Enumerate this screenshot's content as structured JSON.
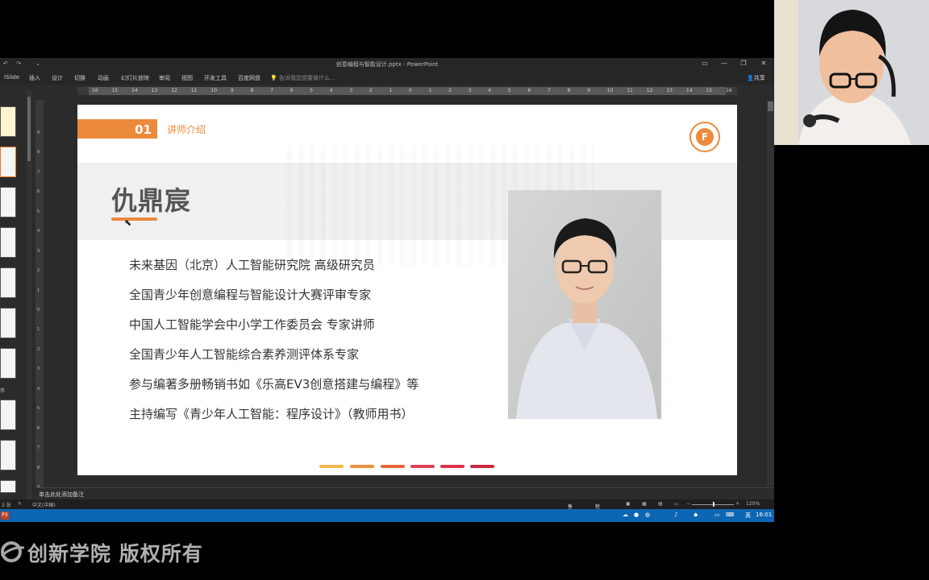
{
  "window": {
    "title": "创意编程与智能设计.pptx - PowerPoint",
    "controls": [
      "▭",
      "—",
      "❐",
      "✕"
    ]
  },
  "ribbon": {
    "tabs": [
      "iSlide",
      "插入",
      "设计",
      "切换",
      "动画",
      "幻灯片放映",
      "审阅",
      "视图",
      "开发工具",
      "百度网盘"
    ],
    "tell_me": "告诉我您想要做什么...",
    "share": "共享"
  },
  "ruler": {
    "h_ticks": [
      "16",
      "15",
      "14",
      "13",
      "12",
      "11",
      "10",
      "9",
      "8",
      "7",
      "6",
      "5",
      "4",
      "3",
      "2",
      "1",
      "0",
      "1",
      "2",
      "3",
      "4",
      "5",
      "6",
      "7",
      "8",
      "9",
      "10",
      "11",
      "12",
      "13",
      "14",
      "15",
      "16"
    ],
    "v_ticks": [
      "9",
      "8",
      "7",
      "6",
      "5",
      "4",
      "3",
      "2",
      "1",
      "0",
      "1",
      "2",
      "3",
      "4",
      "5",
      "6",
      "7",
      "8",
      "9"
    ]
  },
  "slide": {
    "section_number": "01",
    "section_title": "讲师介绍",
    "logo_letter": "F",
    "name": "仇鼎宸",
    "bio": [
      "未来基因（北京）人工智能研究院 高级研究员",
      "全国青少年创意编程与智能设计大赛评审专家",
      "中国人工智能学会中小学工作委员会 专家讲师",
      "全国青少年人工智能综合素养测评体系专家",
      "参与编著多册畅销书如《乐高EV3创意搭建与编程》等",
      "主持编写《青少年人工智能：程序设计》（教师用书）"
    ],
    "dash_colors": [
      "#f1b84b",
      "#ec8f3c",
      "#e4643c",
      "#dc4252",
      "#d8334a",
      "#c8283e"
    ]
  },
  "colors": {
    "accent": "#ec8a3c"
  },
  "thumbnail_label": "参",
  "notes_placeholder": "单击此处添加备注",
  "statusbar": {
    "slide_info": "3 张",
    "language": "中文(中国)",
    "notes_btn": "备注",
    "comments_btn": "批注",
    "zoom": "120%"
  },
  "taskbar": {
    "app_icon": "P3",
    "ime": "英",
    "clock": "16:01"
  },
  "watermark": "创新学院 版权所有"
}
